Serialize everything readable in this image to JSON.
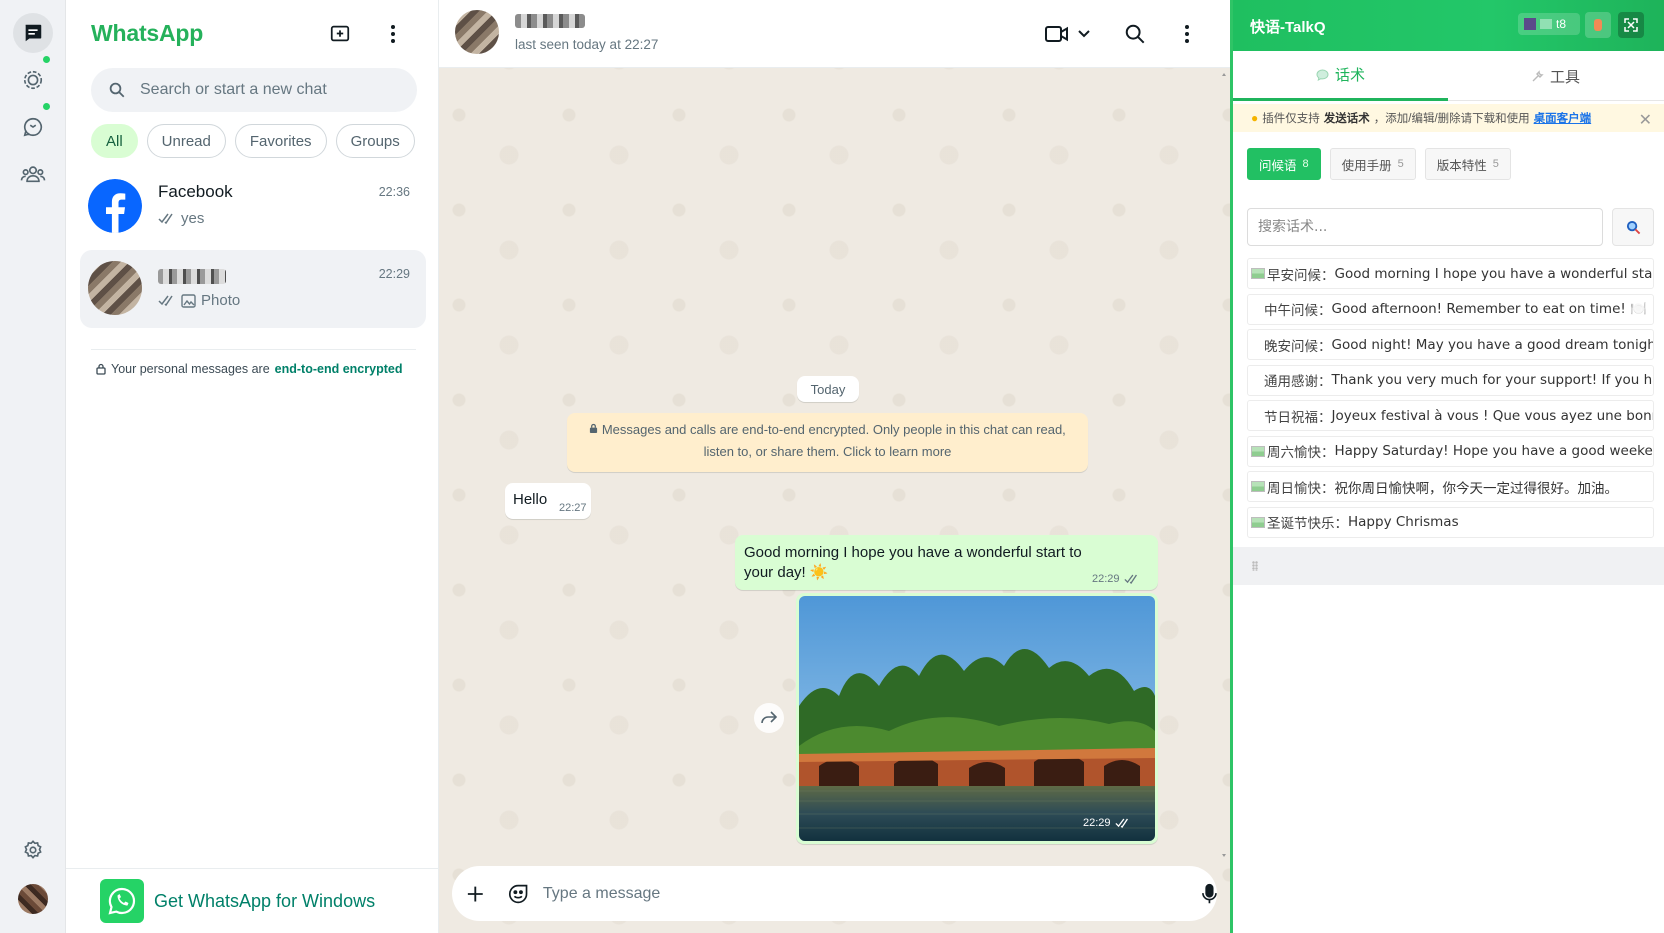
{
  "app": {
    "title": "WhatsApp",
    "search_placeholder": "Search or start a new chat",
    "filters": [
      "All",
      "Unread",
      "Favorites",
      "Groups"
    ],
    "active_filter": "All",
    "chats": [
      {
        "name": "Facebook",
        "time": "22:36",
        "preview": "yes",
        "ticks": "double-check-icon"
      },
      {
        "name": "",
        "time": "22:29",
        "preview": "Photo",
        "ticks": "double-check-icon"
      }
    ],
    "encryption_note": {
      "prefix": "Your personal messages are",
      "link": "end-to-end encrypted"
    },
    "get_app_label": "Get WhatsApp for Windows"
  },
  "conversation": {
    "status": "last seen today at 22:27",
    "date_chip": "Today",
    "system_message_line1": "Messages and calls are end-to-end encrypted. Only people in this chat can read,",
    "system_message_line2": "listen to, or share them. Click to learn more",
    "messages": [
      {
        "direction": "in",
        "text": "Hello",
        "time": "22:27"
      },
      {
        "direction": "out",
        "text": "Good morning I hope you have a wonderful start to your day! ☀️",
        "time": "22:29"
      },
      {
        "direction": "out",
        "type": "image",
        "time": "22:29"
      }
    ],
    "composer_placeholder": "Type a message"
  },
  "talkq": {
    "title": "快语-TalkQ",
    "user_tag": "t8",
    "tabs": [
      {
        "label": "话术",
        "icon": "chat-bubble-icon",
        "active": true
      },
      {
        "label": "工具",
        "icon": "wrench-icon",
        "active": false
      }
    ],
    "notice": {
      "prefix": "插件仅支持",
      "bold": "发送话术",
      "middle": "，添加/编辑/删除请下载和使用",
      "link": "桌面客户端"
    },
    "categories": [
      {
        "label": "问候语",
        "count": "8",
        "active": true
      },
      {
        "label": "使用手册",
        "count": "5",
        "active": false
      },
      {
        "label": "版本特性",
        "count": "5",
        "active": false
      }
    ],
    "search_placeholder": "搜索话术...",
    "items": [
      {
        "label": "早安问候：",
        "text": "Good morning I hope you have a wonderful start t",
        "icon": true
      },
      {
        "label": "中午问候：",
        "text": "Good afternoon! Remember to eat on time! 🍽️",
        "icon": false
      },
      {
        "label": "晚安问候：",
        "text": "Good night! May you have a good dream tonight!",
        "icon": false
      },
      {
        "label": "通用感谢：",
        "text": "Thank you very much for your support! If you have",
        "icon": false
      },
      {
        "label": "节日祝福：",
        "text": "Joyeux festival à vous ! Que vous ayez une bonne :",
        "icon": false
      },
      {
        "label": "周六愉快：",
        "text": "Happy Saturday! Hope you have a good weekend",
        "icon": true
      },
      {
        "label": "周日愉快：",
        "text": "祝你周日愉快啊，你今天一定过得很好。加油。",
        "icon": true
      },
      {
        "label": "圣诞节快乐：",
        "text": "Happy Chrismas",
        "icon": true
      }
    ]
  },
  "colors": {
    "whatsapp_green": "#25b15b",
    "outgoing_bubble": "#d9fdd3",
    "chat_background": "#efeae2",
    "talkq_green": "#22c063"
  }
}
